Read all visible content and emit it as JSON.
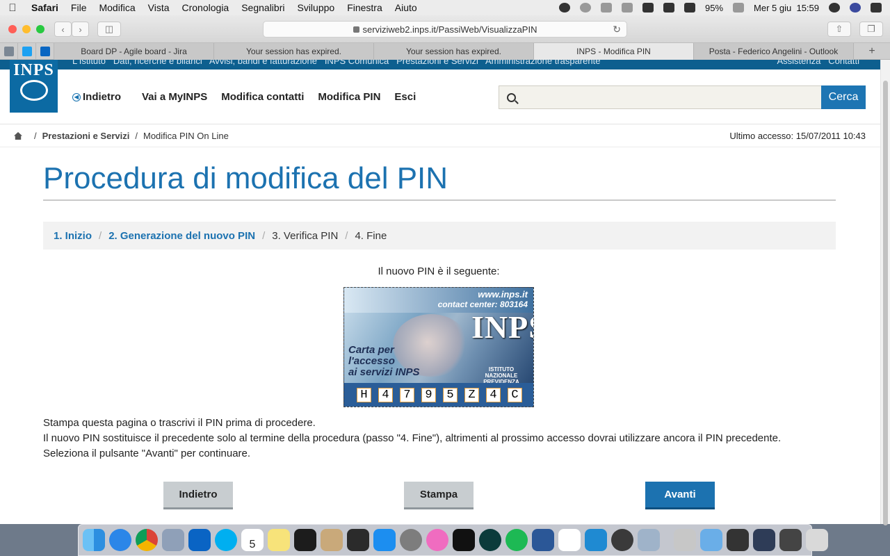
{
  "menubar": {
    "items": [
      "Safari",
      "File",
      "Modifica",
      "Vista",
      "Cronologia",
      "Segnalibri",
      "Sviluppo",
      "Finestra",
      "Aiuto"
    ],
    "battery": "95%",
    "datetime": "Mer 5 giu  15:59"
  },
  "browser": {
    "url": "serviziweb2.inps.it/PassiWeb/VisualizzaPIN",
    "tabs": [
      "Board DP - Agile board - Jira",
      "Your session has expired.",
      "Your session has expired.",
      "INPS - Modifica PIN",
      "Posta - Federico Angelini - Outlook"
    ],
    "new_tab": "+"
  },
  "site": {
    "logo_text": "INPS",
    "top_links": "L'Istituto   Dati, ricerche e bilanci   Avvisi, bandi e fatturazione   INPS Comunica   Prestazioni e Servizi   Amministrazione trasparente",
    "top_right_links": "Assistenza   Contatti",
    "nav": {
      "back": "Indietro",
      "myinps": "Vai a MyINPS",
      "contacts": "Modifica contatti",
      "pin": "Modifica PIN",
      "exit": "Esci"
    },
    "search": {
      "placeholder": "",
      "button": "Cerca"
    },
    "breadcrumb": {
      "level1": "Prestazioni e Servizi",
      "level2": "Modifica PIN On Line",
      "sep": "/"
    },
    "last_access": "Ultimo accesso: 15/07/2011 10:43"
  },
  "main": {
    "title": "Procedura di modifica del PIN",
    "steps": [
      {
        "label": "1. Inizio",
        "done": true
      },
      {
        "label": "2. Generazione del nuovo PIN",
        "done": true
      },
      {
        "label": "3. Verifica PIN",
        "done": false
      },
      {
        "label": "4. Fine",
        "done": false
      }
    ],
    "step_sep": "/",
    "pin_label": "Il nuovo PIN è il seguente:",
    "card": {
      "www": "www.inps.it",
      "contact": "contact center: 803164",
      "brand": "INPS",
      "institute_line1": "ISTITUTO NAZIONALE",
      "institute_line2": "PREVIDENZA SOCIALE",
      "carta_line1": "Carta per",
      "carta_line2": "l'accesso",
      "carta_line3": "ai servizi INPS",
      "pin_digits": [
        "H",
        "4",
        "7",
        "9",
        "5",
        "Z",
        "4",
        "C"
      ]
    },
    "instructions": [
      "Stampa questa pagina o trascrivi il PIN prima di procedere.",
      "Il nuovo PIN sostituisce il precedente solo al termine della procedura (passo \"4. Fine\"), altrimenti al prossimo accesso dovrai utilizzare ancora il PIN precedente.",
      "Seleziona il pulsante \"Avanti\" per continuare."
    ],
    "buttons": {
      "back": "Indietro",
      "print": "Stampa",
      "next": "Avanti"
    }
  },
  "dock": {
    "calendar_day": "5"
  }
}
